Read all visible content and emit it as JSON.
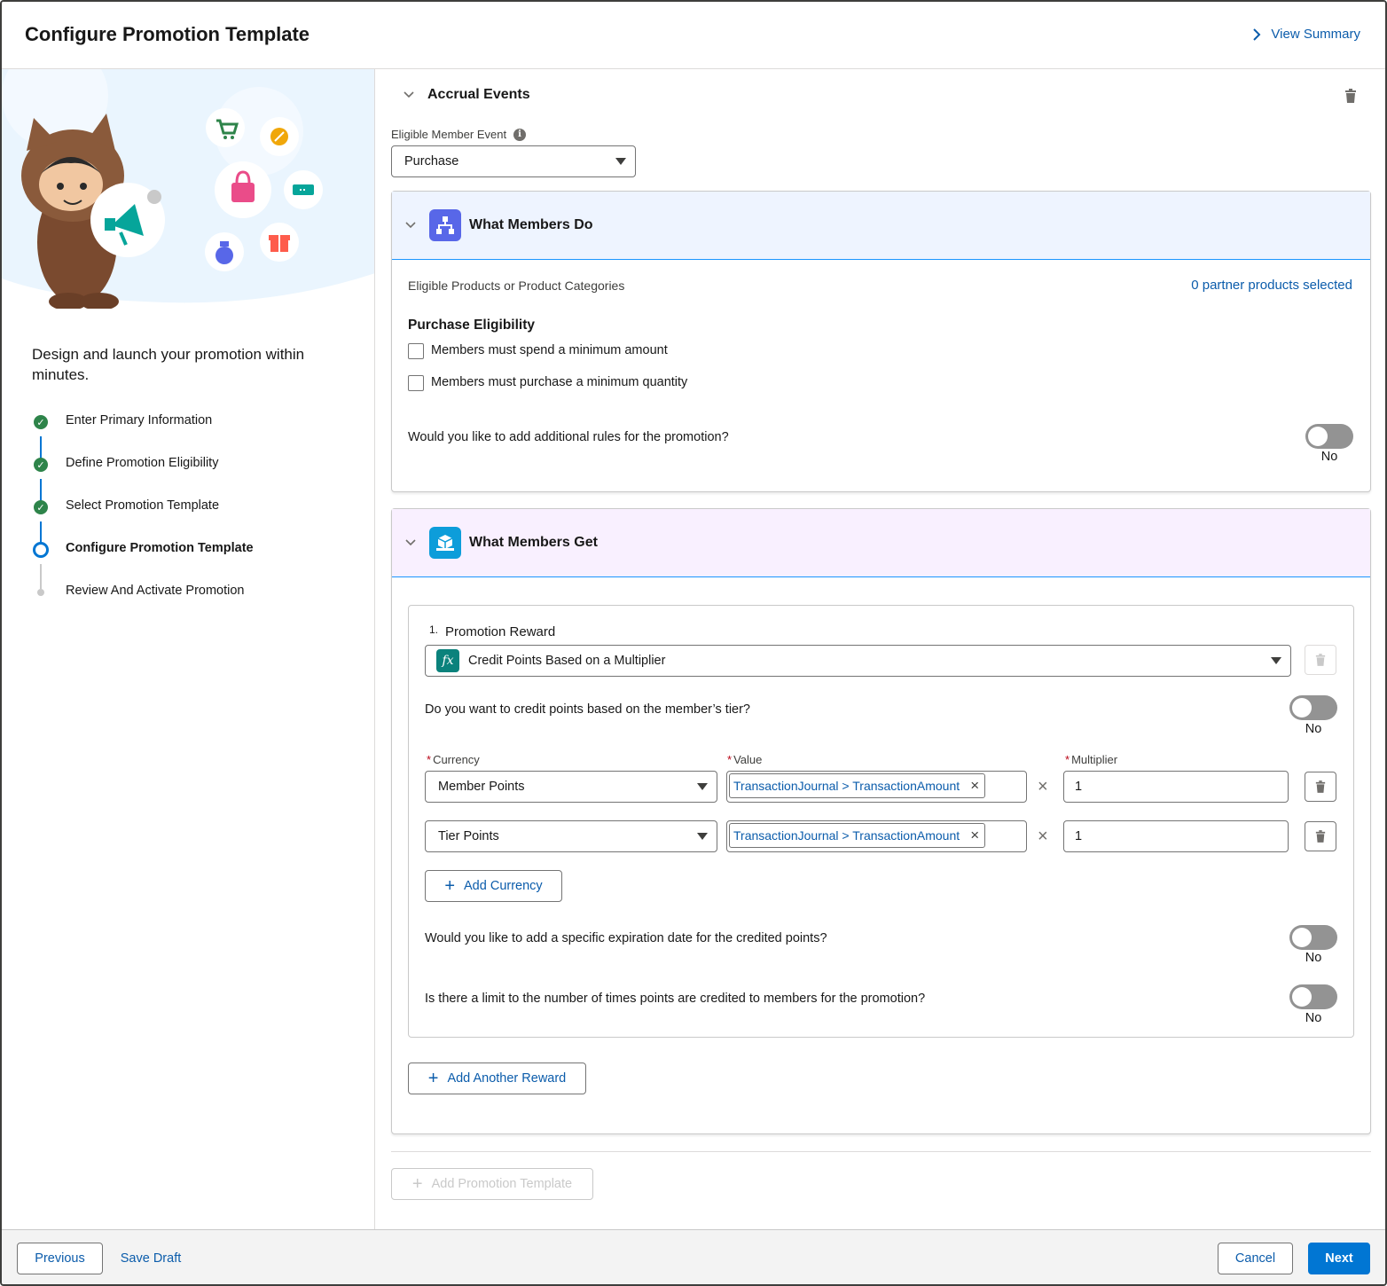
{
  "header": {
    "title": "Configure Promotion Template",
    "view_summary": "View Summary"
  },
  "left": {
    "tagline": "Design and launch your promotion within minutes.",
    "steps": [
      {
        "label": "Enter Primary Information",
        "status": "complete"
      },
      {
        "label": "Define Promotion Eligibility",
        "status": "complete"
      },
      {
        "label": "Select Promotion Template",
        "status": "complete"
      },
      {
        "label": "Configure Promotion Template",
        "status": "current"
      },
      {
        "label": "Review And Activate Promotion",
        "status": "upcoming"
      }
    ]
  },
  "accrual": {
    "title": "Accrual Events",
    "event_label": "Eligible Member Event",
    "event_value": "Purchase"
  },
  "members_do": {
    "title": "What Members Do",
    "products_label": "Eligible Products or Product Categories",
    "products_link": "0 partner products selected",
    "eligibility_title": "Purchase Eligibility",
    "check_spend": "Members must spend a minimum amount",
    "check_quantity": "Members must purchase a minimum quantity",
    "rules_question": "Would you like to add additional rules for the promotion?",
    "rules_toggle": "No"
  },
  "members_get": {
    "title": "What Members Get",
    "reward_number": "1.",
    "reward_label": "Promotion Reward",
    "reward_fx": "fx",
    "reward_value": "Credit Points Based on a Multiplier",
    "tier_question": "Do you want to credit points based on the member’s tier?",
    "tier_toggle": "No",
    "currency_label": "Currency",
    "value_label": "Value",
    "multiplier_label": "Multiplier",
    "required_mark": "*",
    "times_symbol": "×",
    "pill_close": "×",
    "rows": [
      {
        "currency": "Member Points",
        "value": "TransactionJournal > TransactionAmount",
        "multiplier": "1"
      },
      {
        "currency": "Tier Points",
        "value": "TransactionJournal > TransactionAmount",
        "multiplier": "1"
      }
    ],
    "add_currency": "Add Currency",
    "expiration_question": "Would you like to add a specific expiration date for the credited points?",
    "expiration_toggle": "No",
    "limit_question": "Is there a limit to the number of times points are credited to members for the promotion?",
    "limit_toggle": "No",
    "add_reward": "Add Another Reward"
  },
  "add_template": "Add Promotion Template",
  "plus_symbol": "+",
  "footer": {
    "previous": "Previous",
    "save_draft": "Save Draft",
    "cancel": "Cancel",
    "next": "Next"
  },
  "colors": {
    "brand": "#0176d3",
    "link": "#0b5cab",
    "success": "#2e844a",
    "members_do_header": "#eef4ff",
    "members_get_header": "#f9f0ff"
  }
}
